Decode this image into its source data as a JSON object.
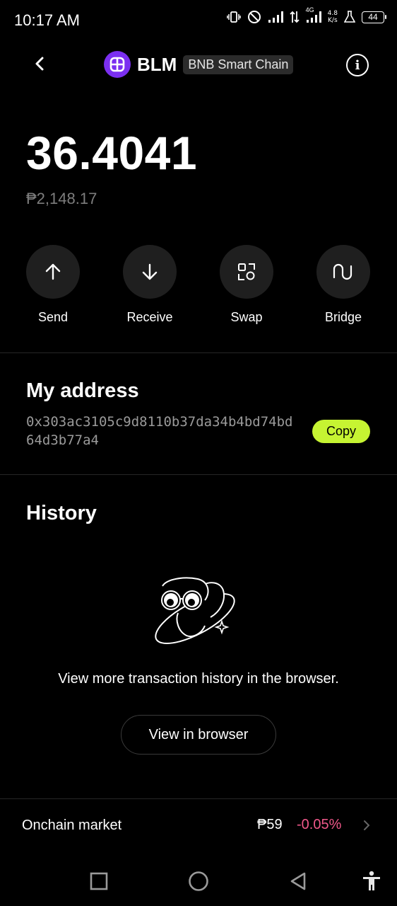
{
  "status_bar": {
    "time": "10:17 AM",
    "net_speed_value": "4.8",
    "net_speed_unit": "K/s",
    "battery": "44",
    "network_type": "4G"
  },
  "header": {
    "back_icon": "chevron-left-icon",
    "token_symbol": "BLM",
    "token_logo_color": "#7b2ff0",
    "chain": "BNB Smart Chain",
    "info_icon": "info-icon"
  },
  "balance": {
    "amount": "36.4041",
    "fiat": "₱2,148.17"
  },
  "actions": [
    {
      "label": "Send",
      "icon": "arrow-up-icon"
    },
    {
      "label": "Receive",
      "icon": "arrow-down-icon"
    },
    {
      "label": "Swap",
      "icon": "swap-icon"
    },
    {
      "label": "Bridge",
      "icon": "bridge-icon"
    }
  ],
  "address_section": {
    "title": "My address",
    "address": "0x303ac3105c9d8110b37da34b4bd74bd64d3b77a4",
    "copy_label": "Copy",
    "copy_color": "#c6f432"
  },
  "history": {
    "title": "History",
    "empty_text": "View more transaction history in the browser.",
    "button_label": "View in browser",
    "illustration": "binoculars-illustration"
  },
  "market": {
    "label": "Onchain market",
    "price": "₱59",
    "change": "-0.05%",
    "change_color": "#f0588a"
  },
  "nav_bar": {
    "items": [
      "recents-icon",
      "home-icon",
      "back-triangle-icon",
      "accessibility-icon"
    ]
  }
}
